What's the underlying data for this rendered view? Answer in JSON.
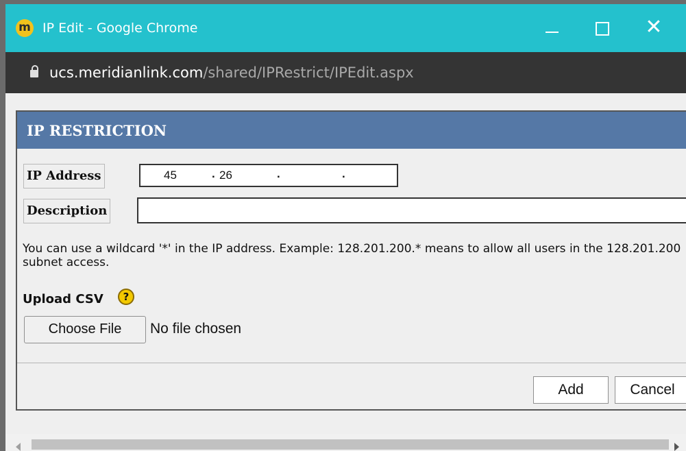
{
  "window": {
    "title": "IP Edit - Google Chrome",
    "icon_letter": "m",
    "controls": {
      "minimize": "minimize-icon",
      "maximize": "maximize-icon",
      "close": "close-icon",
      "close_glyph": "✕"
    }
  },
  "address_bar": {
    "host": "ucs.meridianlink.com",
    "path": "/shared/IPRestrict/IPEdit.aspx"
  },
  "dialog": {
    "title": "IP RESTRICTION",
    "ip_label": "IP Address",
    "ip_parts": [
      "45",
      "26",
      "",
      ""
    ],
    "ip_dots": [
      ".",
      ".",
      "."
    ],
    "description_label": "Description",
    "help_text": "You can use a wildcard '*' in the IP address. Example: 128.201.200.* means to allow all users in the 128.201.200 subnet access.",
    "upload_label": "Upload CSV",
    "help_icon": "?",
    "choose_file_label": "Choose File",
    "no_file_text": "No file chosen",
    "add_label": "Add",
    "cancel_label": "Cancel"
  },
  "colors": {
    "titlebar": "#24c1cd",
    "header": "#5578a6",
    "addressbar": "#343434"
  }
}
